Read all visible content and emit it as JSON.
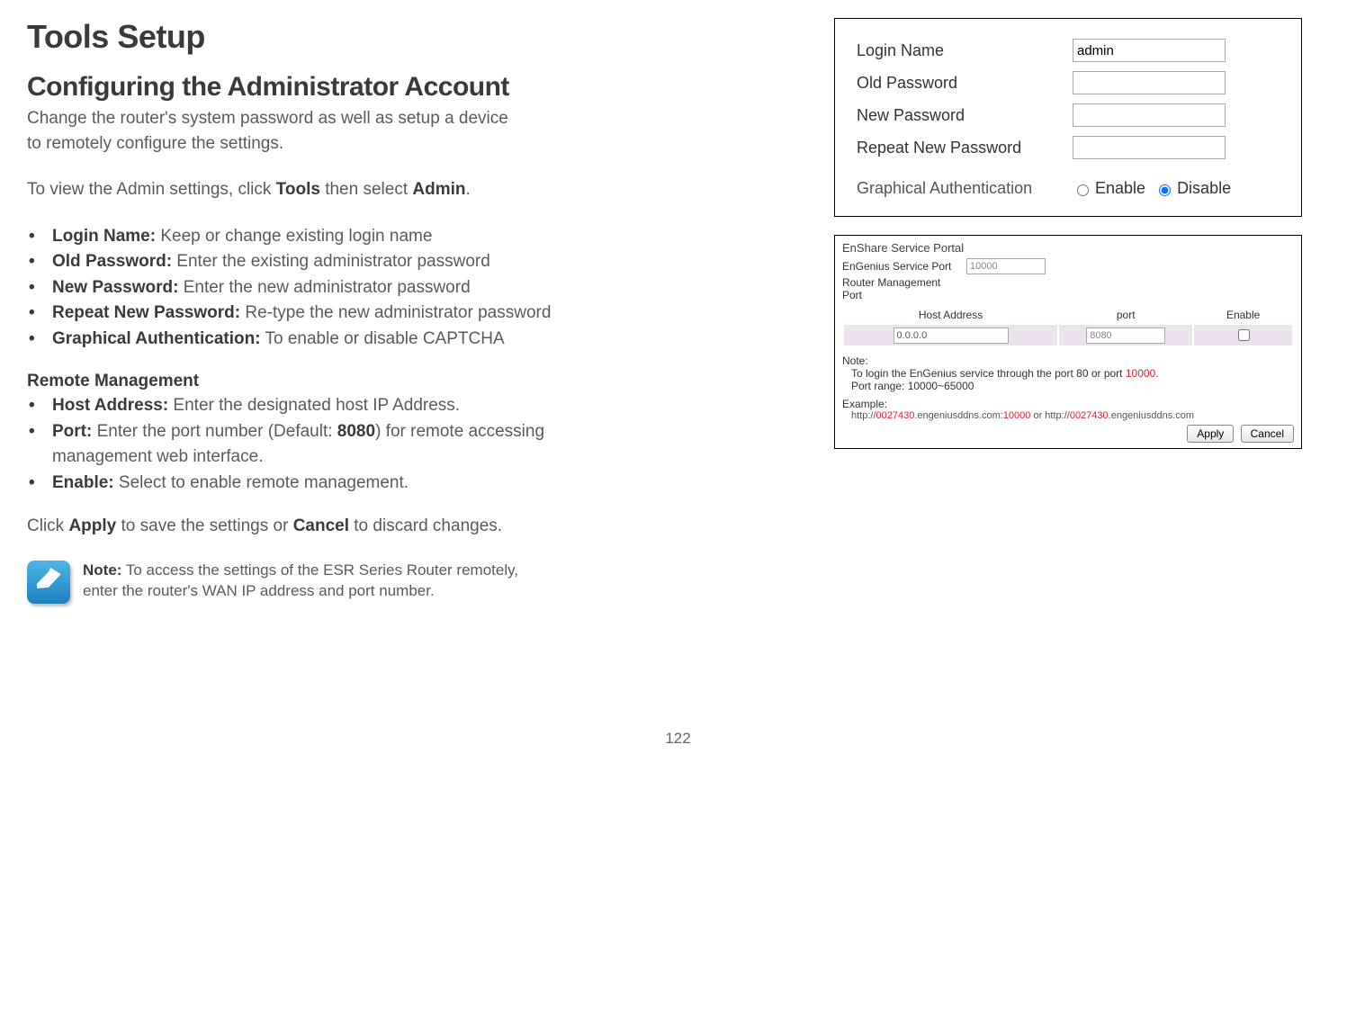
{
  "doc": {
    "title": "Tools Setup",
    "section": "Configuring the Administrator Account",
    "intro_l1": "Change the router's system password as well as setup a device",
    "intro_l2": "to remotely configure the settings.",
    "view_prefix": "To view the Admin settings, click ",
    "view_tools": "Tools",
    "view_mid": " then select ",
    "view_admin": "Admin",
    "view_suffix": ".",
    "bullets": [
      {
        "label": "Login Name:",
        "text": " Keep or change existing login name"
      },
      {
        "label": "Old Password:",
        "text": " Enter the existing administrator password"
      },
      {
        "label": "New Password:",
        "text": " Enter the new administrator password"
      },
      {
        "label": "Repeat New Password:",
        "text": " Re-type the new administrator password"
      },
      {
        "label": "Graphical Authentication:",
        "text": " To enable or disable  CAPTCHA"
      }
    ],
    "remote_heading": "Remote Management",
    "remote": [
      {
        "label": "Host Address:",
        "text": " Enter the designated host IP Address."
      },
      {
        "label": "Port:",
        "text_a": " Enter the port number (Default: ",
        "port": "8080",
        "text_b": ") for remote accessing",
        "cont": "management web interface."
      },
      {
        "label": "Enable:",
        "text": " Select to enable remote management."
      }
    ],
    "apply_line_a": "Click ",
    "apply_b": "Apply",
    "apply_line_b": " to save the settings or ",
    "cancel_b": "Cancel",
    "apply_line_c": " to discard changes.",
    "note_label": "Note:",
    "note_text_a": " To access the settings of the ESR Series Router remotely,",
    "note_text_b": "enter the router's WAN IP address and port number.",
    "page_number": "122"
  },
  "panel_admin": {
    "login_name_label": "Login Name",
    "login_name_value": "admin",
    "old_pw_label": "Old Password",
    "new_pw_label": "New Password",
    "repeat_pw_label": "Repeat New Password",
    "ga_label": "Graphical Authentication",
    "enable": "Enable",
    "disable": "Disable"
  },
  "panel_remote": {
    "portal_title": "EnShare Service Portal",
    "svc_port_label": "EnGenius Service Port",
    "svc_port_value": "10000",
    "mgmt_port_label": "Router Management Port",
    "th_host": "Host Address",
    "th_port": "port",
    "th_enable": "Enable",
    "host_value": "0.0.0.0",
    "port_value": "8080",
    "note_label": "Note:",
    "note_line1_a": "To login the EnGenius service through the port 80 or port ",
    "note_line1_red": "10000.",
    "note_line2": "Port range: 10000~65000",
    "example_label": "Example:",
    "ex_a": "http://",
    "ex_red1": "0027430",
    "ex_b": ".engeniusddns.com:",
    "ex_red2": "10000",
    "ex_c": " or http://",
    "ex_red3": "0027430",
    "ex_d": ".engeniusddns.com",
    "apply": "Apply",
    "cancel": "Cancel"
  }
}
